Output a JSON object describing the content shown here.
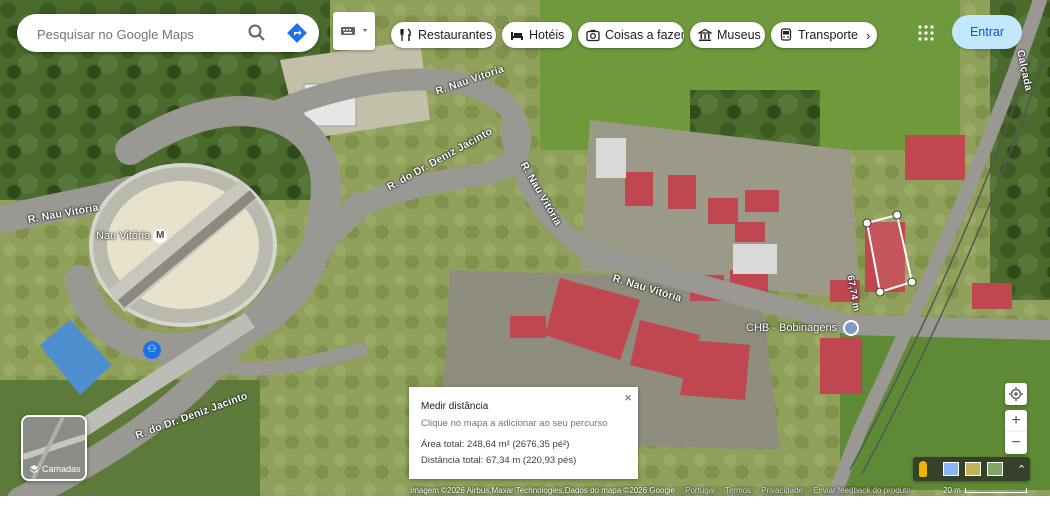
{
  "search": {
    "placeholder": "Pesquisar no Google Maps"
  },
  "chips": [
    {
      "label": "Restaurantes",
      "icon": "fork-knife-icon"
    },
    {
      "label": "Hotéis",
      "icon": "bed-icon"
    },
    {
      "label": "Coisas a fazer",
      "icon": "camera-icon"
    },
    {
      "label": "Museus",
      "icon": "museum-icon"
    },
    {
      "label": "Transporte",
      "icon": "bus-icon"
    }
  ],
  "header": {
    "signin_label": "Entrar"
  },
  "streets": {
    "nau_vitoria_top": "R. Nau Vitória",
    "deniz_jacinto_upper": "R. do Dr. Deniz Jacinto",
    "nau_vitoria_vertical": "R. Nau Vitória",
    "nau_vitoria_left": "R. Nau Vitória",
    "nau_vitoria_middle": "R. Nau Vitória",
    "deniz_jacinto_lower": "R. do Dr. Deniz Jacinto",
    "calcada": "Calçada"
  },
  "places": {
    "metro_station": "Nau Vitória",
    "business": "CHB - Bobinagens",
    "measure_edge": "67,74 m"
  },
  "measure_panel": {
    "title": "Medir distância",
    "subtitle": "Clique no mapa a adicionar ao seu percurso",
    "area": "Área total: 248,64 m² (2676,35 pé²)",
    "distance": "Distância total: 67,34 m (220,93 pés)",
    "close": "×"
  },
  "layers": {
    "label": "Camadas"
  },
  "zoom": {
    "in": "+",
    "out": "−"
  },
  "footer": {
    "imagery": "Imagem ©2026 Airbus,Maxar Technologies,Dados do mapa ©2026 Google",
    "country": "Portugal",
    "terms": "Termos",
    "privacy": "Privacidade",
    "feedback": "Enviar feedback do produto",
    "scale": "20 m"
  },
  "colors": {
    "signin_bg": "#c2e7ff",
    "signin_text": "#0b57d0",
    "directions": "#1a73e8"
  }
}
